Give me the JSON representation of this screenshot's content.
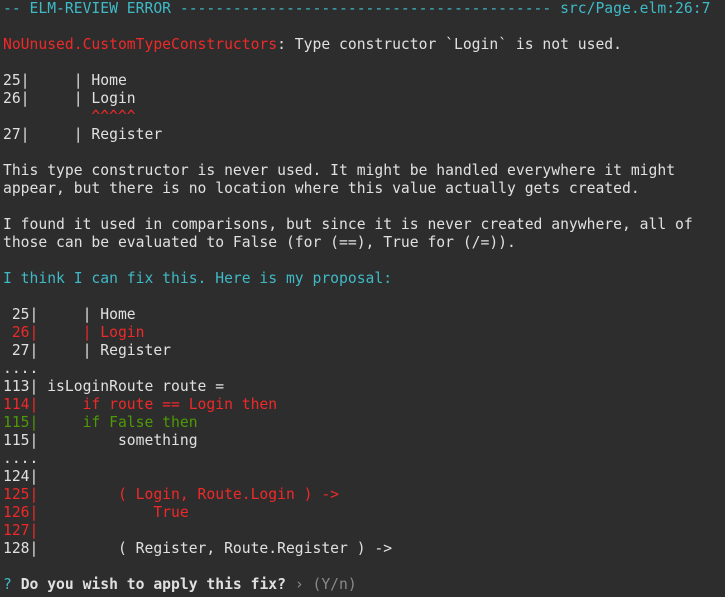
{
  "header": {
    "title": "-- ELM-REVIEW ERROR ------------------------------------------ src/Page.elm:26:7"
  },
  "error": {
    "rule": "NoUnused.CustomTypeConstructors",
    "message": ": Type constructor `Login` is not used."
  },
  "snippet": [
    "25|     | Home",
    "26|     | Login",
    "          ^^^^^",
    "27|     | Register"
  ],
  "explanation": {
    "p1_l1": "This type constructor is never used. It might be handled everywhere it might",
    "p1_l2": "appear, but there is no location where this value actually gets created.",
    "p2_l1": "I found it used in comparisons, but since it is never created anywhere, all of",
    "p2_l2": "those can be evaluated to False (for (==), True for (/=))."
  },
  "proposal_intro": "I think I can fix this. Here is my proposal:",
  "diff": {
    "l25": " 25|     | Home",
    "l26": " 26|     | Login",
    "l27": " 27|     | Register",
    "ellipsis1": "....",
    "l113": "113| isLoginRoute route =",
    "l114": "114|     if route == Login then",
    "l115a": "115|     if False then",
    "l115b": "115|         something",
    "ellipsis2": "....",
    "l124": "124|",
    "l125": "125|         ( Login, Route.Login ) ->",
    "l126": "126|             True",
    "l127": "127|",
    "l128": "128|         ( Register, Route.Register ) ->"
  },
  "prompt": {
    "mark": "?",
    "question": "Do you wish to apply this fix?",
    "arrow": "›",
    "choices": "(Y/n)"
  },
  "colors": {
    "background": "#2d2d2d",
    "header": "#3fb9c6",
    "removed": "#ef2929",
    "added": "#4e9a06",
    "text": "#e0e0e0"
  }
}
